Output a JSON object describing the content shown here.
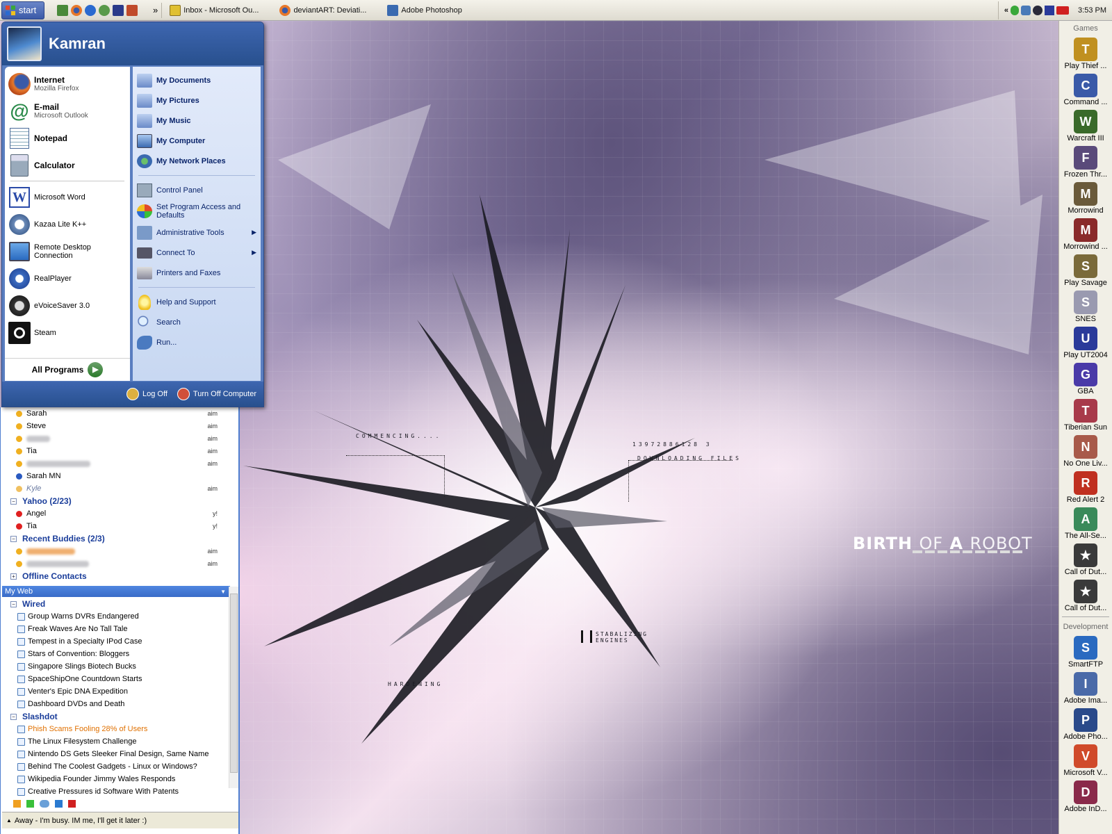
{
  "taskbar": {
    "start_label": "start",
    "tasks": [
      {
        "label": "Inbox - Microsoft Ou...",
        "icon": "outlook-icon"
      },
      {
        "label": "deviantART: Deviati...",
        "icon": "firefox-icon"
      },
      {
        "label": "Adobe Photoshop",
        "icon": "photoshop-icon"
      }
    ],
    "more_label": "»",
    "tray_expand": "«",
    "clock": "3:53 PM"
  },
  "start_menu": {
    "user": "Kamran",
    "pinned": [
      {
        "title": "Internet",
        "subtitle": "Mozilla Firefox",
        "icon": "firefox-icon"
      },
      {
        "title": "E-mail",
        "subtitle": "Microsoft Outlook",
        "icon": "email-icon"
      },
      {
        "title": "Notepad",
        "icon": "notepad-icon"
      },
      {
        "title": "Calculator",
        "icon": "calculator-icon"
      }
    ],
    "recent": [
      {
        "label": "Microsoft Word",
        "icon": "word-icon"
      },
      {
        "label": "Kazaa Lite K++",
        "icon": "kazaa-icon"
      },
      {
        "label": "Remote Desktop Connection",
        "icon": "remote-desktop-icon"
      },
      {
        "label": "RealPlayer",
        "icon": "realplayer-icon"
      },
      {
        "label": "eVoiceSaver 3.0",
        "icon": "evoicesaver-icon"
      },
      {
        "label": "Steam",
        "icon": "steam-icon"
      }
    ],
    "all_programs": "All Programs",
    "right_bold": [
      {
        "label": "My Documents",
        "icon": "folder-documents-icon"
      },
      {
        "label": "My Pictures",
        "icon": "folder-pictures-icon"
      },
      {
        "label": "My Music",
        "icon": "folder-music-icon"
      },
      {
        "label": "My Computer",
        "icon": "computer-icon"
      },
      {
        "label": "My Network Places",
        "icon": "network-icon"
      }
    ],
    "right_tools": [
      {
        "label": "Control Panel",
        "icon": "control-panel-icon"
      },
      {
        "label": "Set Program Access and Defaults",
        "icon": "program-access-icon"
      },
      {
        "label": "Administrative Tools",
        "icon": "admin-tools-icon",
        "submenu": true
      },
      {
        "label": "Connect To",
        "icon": "connect-icon",
        "submenu": true
      },
      {
        "label": "Printers and Faxes",
        "icon": "printer-icon"
      }
    ],
    "right_help": [
      {
        "label": "Help and Support",
        "icon": "help-icon"
      },
      {
        "label": "Search",
        "icon": "search-icon"
      },
      {
        "label": "Run...",
        "icon": "run-icon"
      }
    ],
    "log_off": "Log Off",
    "turn_off": "Turn Off Computer"
  },
  "buddy_list": {
    "contacts_top": [
      {
        "name": "Sarah",
        "net": "aim",
        "status": "away"
      },
      {
        "name": "Steve",
        "net": "aim",
        "status": "away"
      },
      {
        "name": "",
        "net": "aim",
        "status": "away",
        "blurred": true
      },
      {
        "name": "Tia",
        "net": "aim",
        "status": "away"
      },
      {
        "name": "",
        "net": "aim",
        "status": "away",
        "blurred": true
      },
      {
        "name": "Sarah MN",
        "net": "",
        "status": "msn"
      },
      {
        "name": "Kyle",
        "net": "aim",
        "status": "idle"
      }
    ],
    "yahoo_group": "Yahoo (2/23)",
    "yahoo": [
      {
        "name": "Angel",
        "net": "y!"
      },
      {
        "name": "Tia",
        "net": "y!"
      }
    ],
    "recent_group": "Recent Buddies (2/3)",
    "recent": [
      {
        "name": "",
        "net": "aim"
      },
      {
        "name": "",
        "net": "aim"
      }
    ],
    "offline_group": "Offline Contacts",
    "myweb_title": "My Web",
    "wired_group": "Wired",
    "wired": [
      "Group Warns DVRs Endangered",
      "Freak Waves Are No Tall Tale",
      "Tempest in a Specialty IPod Case",
      "Stars of Convention: Bloggers",
      "Singapore Slings Biotech Bucks",
      "SpaceShipOne Countdown Starts",
      "Venter's Epic DNA Expedition",
      "Dashboard DVDs and Death"
    ],
    "slashdot_group": "Slashdot",
    "slashdot": [
      "Phish Scams Fooling 28% of Users",
      "The Linux Filesystem Challenge",
      "Nintendo DS Gets Sleeker Final Design, Same Name",
      "Behind The Coolest Gadgets - Linux or Windows?",
      "Wikipedia Founder Jimmy Wales Responds",
      "Creative Pressures id Software With Patents"
    ],
    "status_msg": "Away - I'm busy. IM me, I'll get it later :)"
  },
  "wallpaper": {
    "title_bold1": "BIRTH",
    "title_thin": "OF",
    "title_bold2": "A",
    "title_thin2": "ROBOT",
    "commencing": "COMMENCING....",
    "numbers": "13972886128 3",
    "downloading": "DOWNLOADING FILES",
    "stabalizing": "STABALIZING",
    "engines": "ENGINES",
    "hardening": "HARDENING"
  },
  "dock": {
    "games_label": "Games",
    "games": [
      {
        "label": "Play Thief ...",
        "color": "#c09020",
        "glyph": "T"
      },
      {
        "label": "Command ...",
        "color": "#3a5aa8",
        "glyph": "C"
      },
      {
        "label": "Warcraft III",
        "color": "#3a6a2a",
        "glyph": "W"
      },
      {
        "label": "Frozen Thr...",
        "color": "#5a4a7a",
        "glyph": "F"
      },
      {
        "label": "Morrowind",
        "color": "#6a5a3a",
        "glyph": "M"
      },
      {
        "label": "Morrowind ...",
        "color": "#8a2a2a",
        "glyph": "M"
      },
      {
        "label": "Play Savage",
        "color": "#7a6a3a",
        "glyph": "S"
      },
      {
        "label": "SNES",
        "color": "#9a9ab0",
        "glyph": "S"
      },
      {
        "label": "Play UT2004",
        "color": "#2a3a9a",
        "glyph": "U"
      },
      {
        "label": "GBA",
        "color": "#4a3aa8",
        "glyph": "G"
      },
      {
        "label": "Tiberian Sun",
        "color": "#a83a4a",
        "glyph": "T"
      },
      {
        "label": "No One Liv...",
        "color": "#a85a4a",
        "glyph": "N"
      },
      {
        "label": "Red Alert 2",
        "color": "#c03020",
        "glyph": "R"
      },
      {
        "label": "The All-Se...",
        "color": "#3a8a5a",
        "glyph": "A"
      },
      {
        "label": "Call of Dut...",
        "color": "#3a3a3a",
        "glyph": "★"
      },
      {
        "label": "Call of Dut...",
        "color": "#3a3a3a",
        "glyph": "★"
      }
    ],
    "dev_label": "Development",
    "dev": [
      {
        "label": "SmartFTP",
        "color": "#2a6ac0",
        "glyph": "S"
      },
      {
        "label": "Adobe Ima...",
        "color": "#4a6aa8",
        "glyph": "I"
      },
      {
        "label": "Adobe Pho...",
        "color": "#2a4a8a",
        "glyph": "P"
      },
      {
        "label": "Microsoft V...",
        "color": "#d04a2a",
        "glyph": "V"
      },
      {
        "label": "Adobe InD...",
        "color": "#8a2a4a",
        "glyph": "D"
      }
    ]
  }
}
